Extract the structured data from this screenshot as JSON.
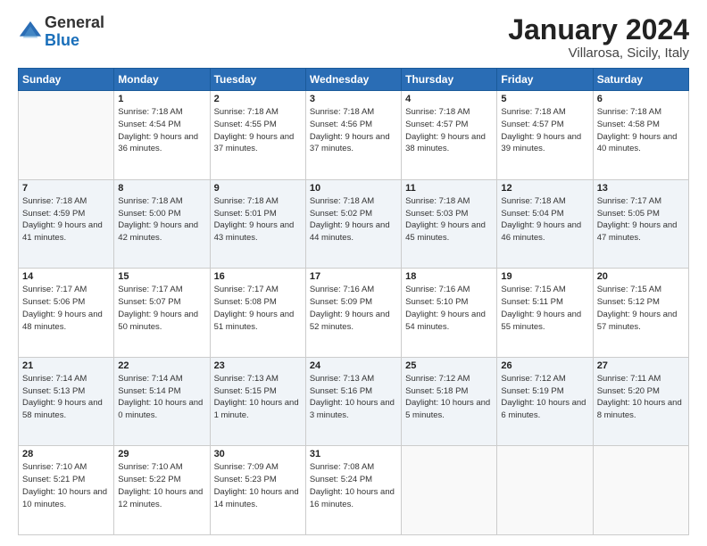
{
  "logo": {
    "general": "General",
    "blue": "Blue"
  },
  "title": "January 2024",
  "location": "Villarosa, Sicily, Italy",
  "weekdays": [
    "Sunday",
    "Monday",
    "Tuesday",
    "Wednesday",
    "Thursday",
    "Friday",
    "Saturday"
  ],
  "weeks": [
    [
      {
        "day": "",
        "sunrise": "",
        "sunset": "",
        "daylight": ""
      },
      {
        "day": "1",
        "sunrise": "Sunrise: 7:18 AM",
        "sunset": "Sunset: 4:54 PM",
        "daylight": "Daylight: 9 hours and 36 minutes."
      },
      {
        "day": "2",
        "sunrise": "Sunrise: 7:18 AM",
        "sunset": "Sunset: 4:55 PM",
        "daylight": "Daylight: 9 hours and 37 minutes."
      },
      {
        "day": "3",
        "sunrise": "Sunrise: 7:18 AM",
        "sunset": "Sunset: 4:56 PM",
        "daylight": "Daylight: 9 hours and 37 minutes."
      },
      {
        "day": "4",
        "sunrise": "Sunrise: 7:18 AM",
        "sunset": "Sunset: 4:57 PM",
        "daylight": "Daylight: 9 hours and 38 minutes."
      },
      {
        "day": "5",
        "sunrise": "Sunrise: 7:18 AM",
        "sunset": "Sunset: 4:57 PM",
        "daylight": "Daylight: 9 hours and 39 minutes."
      },
      {
        "day": "6",
        "sunrise": "Sunrise: 7:18 AM",
        "sunset": "Sunset: 4:58 PM",
        "daylight": "Daylight: 9 hours and 40 minutes."
      }
    ],
    [
      {
        "day": "7",
        "sunrise": "Sunrise: 7:18 AM",
        "sunset": "Sunset: 4:59 PM",
        "daylight": "Daylight: 9 hours and 41 minutes."
      },
      {
        "day": "8",
        "sunrise": "Sunrise: 7:18 AM",
        "sunset": "Sunset: 5:00 PM",
        "daylight": "Daylight: 9 hours and 42 minutes."
      },
      {
        "day": "9",
        "sunrise": "Sunrise: 7:18 AM",
        "sunset": "Sunset: 5:01 PM",
        "daylight": "Daylight: 9 hours and 43 minutes."
      },
      {
        "day": "10",
        "sunrise": "Sunrise: 7:18 AM",
        "sunset": "Sunset: 5:02 PM",
        "daylight": "Daylight: 9 hours and 44 minutes."
      },
      {
        "day": "11",
        "sunrise": "Sunrise: 7:18 AM",
        "sunset": "Sunset: 5:03 PM",
        "daylight": "Daylight: 9 hours and 45 minutes."
      },
      {
        "day": "12",
        "sunrise": "Sunrise: 7:18 AM",
        "sunset": "Sunset: 5:04 PM",
        "daylight": "Daylight: 9 hours and 46 minutes."
      },
      {
        "day": "13",
        "sunrise": "Sunrise: 7:17 AM",
        "sunset": "Sunset: 5:05 PM",
        "daylight": "Daylight: 9 hours and 47 minutes."
      }
    ],
    [
      {
        "day": "14",
        "sunrise": "Sunrise: 7:17 AM",
        "sunset": "Sunset: 5:06 PM",
        "daylight": "Daylight: 9 hours and 48 minutes."
      },
      {
        "day": "15",
        "sunrise": "Sunrise: 7:17 AM",
        "sunset": "Sunset: 5:07 PM",
        "daylight": "Daylight: 9 hours and 50 minutes."
      },
      {
        "day": "16",
        "sunrise": "Sunrise: 7:17 AM",
        "sunset": "Sunset: 5:08 PM",
        "daylight": "Daylight: 9 hours and 51 minutes."
      },
      {
        "day": "17",
        "sunrise": "Sunrise: 7:16 AM",
        "sunset": "Sunset: 5:09 PM",
        "daylight": "Daylight: 9 hours and 52 minutes."
      },
      {
        "day": "18",
        "sunrise": "Sunrise: 7:16 AM",
        "sunset": "Sunset: 5:10 PM",
        "daylight": "Daylight: 9 hours and 54 minutes."
      },
      {
        "day": "19",
        "sunrise": "Sunrise: 7:15 AM",
        "sunset": "Sunset: 5:11 PM",
        "daylight": "Daylight: 9 hours and 55 minutes."
      },
      {
        "day": "20",
        "sunrise": "Sunrise: 7:15 AM",
        "sunset": "Sunset: 5:12 PM",
        "daylight": "Daylight: 9 hours and 57 minutes."
      }
    ],
    [
      {
        "day": "21",
        "sunrise": "Sunrise: 7:14 AM",
        "sunset": "Sunset: 5:13 PM",
        "daylight": "Daylight: 9 hours and 58 minutes."
      },
      {
        "day": "22",
        "sunrise": "Sunrise: 7:14 AM",
        "sunset": "Sunset: 5:14 PM",
        "daylight": "Daylight: 10 hours and 0 minutes."
      },
      {
        "day": "23",
        "sunrise": "Sunrise: 7:13 AM",
        "sunset": "Sunset: 5:15 PM",
        "daylight": "Daylight: 10 hours and 1 minute."
      },
      {
        "day": "24",
        "sunrise": "Sunrise: 7:13 AM",
        "sunset": "Sunset: 5:16 PM",
        "daylight": "Daylight: 10 hours and 3 minutes."
      },
      {
        "day": "25",
        "sunrise": "Sunrise: 7:12 AM",
        "sunset": "Sunset: 5:18 PM",
        "daylight": "Daylight: 10 hours and 5 minutes."
      },
      {
        "day": "26",
        "sunrise": "Sunrise: 7:12 AM",
        "sunset": "Sunset: 5:19 PM",
        "daylight": "Daylight: 10 hours and 6 minutes."
      },
      {
        "day": "27",
        "sunrise": "Sunrise: 7:11 AM",
        "sunset": "Sunset: 5:20 PM",
        "daylight": "Daylight: 10 hours and 8 minutes."
      }
    ],
    [
      {
        "day": "28",
        "sunrise": "Sunrise: 7:10 AM",
        "sunset": "Sunset: 5:21 PM",
        "daylight": "Daylight: 10 hours and 10 minutes."
      },
      {
        "day": "29",
        "sunrise": "Sunrise: 7:10 AM",
        "sunset": "Sunset: 5:22 PM",
        "daylight": "Daylight: 10 hours and 12 minutes."
      },
      {
        "day": "30",
        "sunrise": "Sunrise: 7:09 AM",
        "sunset": "Sunset: 5:23 PM",
        "daylight": "Daylight: 10 hours and 14 minutes."
      },
      {
        "day": "31",
        "sunrise": "Sunrise: 7:08 AM",
        "sunset": "Sunset: 5:24 PM",
        "daylight": "Daylight: 10 hours and 16 minutes."
      },
      {
        "day": "",
        "sunrise": "",
        "sunset": "",
        "daylight": ""
      },
      {
        "day": "",
        "sunrise": "",
        "sunset": "",
        "daylight": ""
      },
      {
        "day": "",
        "sunrise": "",
        "sunset": "",
        "daylight": ""
      }
    ]
  ]
}
